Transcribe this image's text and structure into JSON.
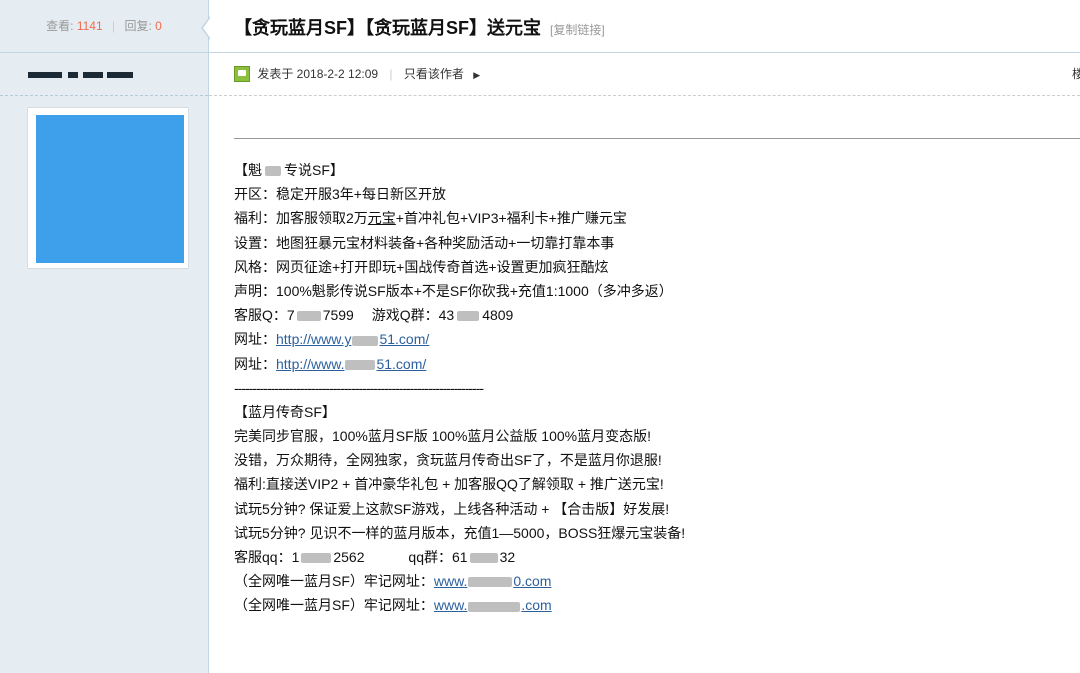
{
  "sidebar": {
    "views_label": "查看:",
    "views": "1141",
    "replies_label": "回复:",
    "replies": "0"
  },
  "thread": {
    "title": "【贪玩蓝月SF】【贪玩蓝月SF】送元宝",
    "copy_link": "[复制链接]"
  },
  "post_meta": {
    "posted": "发表于 2018-2-2 12:09",
    "author_only": "只看该作者",
    "floor_char": "楼"
  },
  "content": {
    "s1_head_a": "【魁",
    "s1_head_b": "专说SF】",
    "l1": "开区：稳定开服3年+每日新区开放",
    "l2a": "福利：加客服领取2万",
    "l2b": "元宝",
    "l2c": "+首冲礼包+VIP3+福利卡+推广赚元宝",
    "l3": "设置：地图狂暴元宝材料装备+各种奖励活动+一切靠打靠本事",
    "l4": "风格：网页征途+打开即玩+国战传奇首选+设置更加疯狂酷炫",
    "l5": "声明：100%魁影传说SF版本+不是SF你砍我+充值1:1000（多冲多返）",
    "l6a": "客服Q：7",
    "l6b": "7599",
    "l6c": "游戏Q群：43",
    "l6d": "4809",
    "l7a": "网址：",
    "l7_link_a": "http://www.y",
    "l7_link_b": "51.com/",
    "l8a": "网址：",
    "l8_link_a": "http://www.",
    "l8_link_b": "51.com/",
    "divider": "--------------------------------------------------------------------",
    "s2_head": "【蓝月传奇SF】",
    "m1": "完美同步官服，100%蓝月SF版   100%蓝月公益版   100%蓝月变态版!",
    "m2": "没错，万众期待，全网独家，贪玩蓝月传奇出SF了，不是蓝月你退服!",
    "m3": "福利:直接送VIP2 + 首冲豪华礼包 + 加客服QQ了解领取 + 推广送元宝!",
    "m4": "试玩5分钟? 保证爱上这款SF游戏，上线各种活动 + 【合击版】好发展!",
    "m5": "试玩5分钟? 见识不一样的蓝月版本，充值1—5000，BOSS狂爆元宝装备!",
    "m6a": "客服qq：1",
    "m6b": "2562",
    "m6c": "qq群：61",
    "m6d": "32",
    "m7a": "（全网唯一蓝月SF）牢记网址：",
    "m7_link_a": "www.",
    "m7_link_b": "0.com",
    "m8a": "（全网唯一蓝月SF）牢记网址：",
    "m8_link_a": "www.",
    "m8_link_b": ".com"
  },
  "colors": {
    "sidebar_bg": "#e5edf2",
    "count_accent": "#f26c4f",
    "avatar": "#3ea0ea",
    "link": "#2b5f9e"
  }
}
